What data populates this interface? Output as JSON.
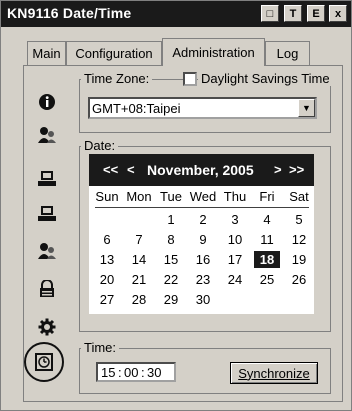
{
  "window": {
    "title": "KN9116 Date/Time"
  },
  "titlebar_buttons": [
    "□",
    "T",
    "E",
    "x"
  ],
  "tabs": [
    {
      "label": "Main"
    },
    {
      "label": "Configuration"
    },
    {
      "label": "Administration"
    },
    {
      "label": "Log"
    }
  ],
  "active_tab": "Administration",
  "sidebar_icons": [
    "info-icon",
    "user-icon",
    "device-icon",
    "device-icon",
    "users-icon",
    "lock-icon",
    "gear-icon",
    "clock-icon"
  ],
  "timezone": {
    "label": "Time Zone:",
    "value": "GMT+08:Taipei",
    "dst_label": "Daylight Savings Time",
    "dst_checked": false
  },
  "date": {
    "label": "Date:",
    "nav_prev_year": "<<",
    "nav_prev_month": "<",
    "nav_next_month": ">",
    "nav_next_year": ">>",
    "month_label": "November, 2005",
    "weekdays": [
      "Sun",
      "Mon",
      "Tue",
      "Wed",
      "Thu",
      "Fri",
      "Sat"
    ],
    "first_weekday_index": 2,
    "days_in_month": 30,
    "selected_day": 18
  },
  "time": {
    "label": "Time:",
    "hours": "15",
    "minutes": "00",
    "seconds": "30",
    "sync_label": "Synchronize"
  },
  "colors": {
    "titlebar": "#1a1a1a",
    "face": "#d4d0c8",
    "selected": "#1a1a1a"
  }
}
